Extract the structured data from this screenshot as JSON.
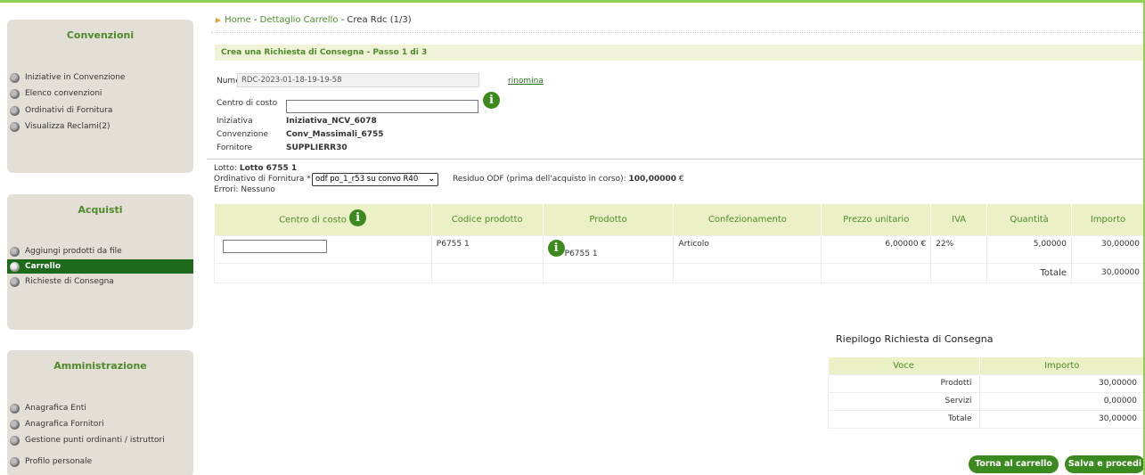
{
  "sidebar": {
    "sections": [
      {
        "title": "Convenzioni",
        "items": [
          {
            "label": "Iniziative in Convenzione"
          },
          {
            "label": "Elenco convenzioni"
          },
          {
            "label": "Ordinativi di Fornitura"
          },
          {
            "label": "Visualizza Reclami(2)"
          }
        ]
      },
      {
        "title": "Acquisti",
        "items": [
          {
            "label": "Aggiungi prodotti da file"
          },
          {
            "label": "Carrello",
            "active": true
          },
          {
            "label": "Richieste di Consegna"
          }
        ]
      },
      {
        "title": "Amministrazione",
        "items": [
          {
            "label": "Anagrafica Enti"
          },
          {
            "label": "Anagrafica Fornitori"
          },
          {
            "label": "Gestione punti ordinanti / istruttori"
          },
          {
            "label": "Profilo personale"
          }
        ]
      }
    ]
  },
  "breadcrumb": {
    "home": "Home",
    "sep1": " - ",
    "cart": "Dettaglio Carrello",
    "sep2": " - ",
    "current": "Crea Rdc (1/3)"
  },
  "step_title": "Crea una Richiesta di Consegna - Passo 1 di 3",
  "form": {
    "numero_label": "Numero Rdc Ente",
    "numero_value": "RDC-2023-01-18-19-19-58",
    "rename_link": "rinomina",
    "centro_label": "Centro di costo",
    "centro_value": "",
    "iniziativa_label": "Iniziativa",
    "iniziativa_value": "Iniziativa_NCV_6078",
    "convenzione_label": "Convenzione",
    "convenzione_value": "Conv_Massimali_6755",
    "fornitore_label": "Fornitore",
    "fornitore_value": "SUPPLIERR30"
  },
  "lotto": {
    "lotto_label": "Lotto:",
    "lotto_value": "Lotto 6755 1",
    "ordinativo_label": "Ordinativo di Fornitura *",
    "ordinativo_selected": "odf po_1_r53 su convo R40",
    "residuo_label": "Residuo ODF (prima dell'acquisto in corso):",
    "residuo_value": "100,00000",
    "residuo_currency": "€",
    "errori_label": "Errori:",
    "errori_value": "Nessuno"
  },
  "cart_table": {
    "headers": [
      "Centro di costo",
      "Codice prodotto",
      "Prodotto",
      "Confezionamento",
      "Prezzo unitario",
      "IVA",
      "Quantità",
      "Importo"
    ],
    "row": {
      "centro": "",
      "codice": "P6755 1",
      "prodotto": "P6755 1",
      "confezionamento": "Articolo",
      "prezzo": "6,00000 €",
      "iva": "22%",
      "quantita": "5,00000",
      "importo": "30,00000"
    },
    "totale_label": "Totale",
    "totale_value": "30,00000"
  },
  "summary": {
    "title": "Riepilogo Richiesta di Consegna",
    "headers": [
      "Voce",
      "Importo"
    ],
    "rows": [
      {
        "voce": "Prodotti",
        "importo": "30,00000"
      },
      {
        "voce": "Servizi",
        "importo": "0,00000"
      },
      {
        "voce": "Totale",
        "importo": "30,00000"
      }
    ]
  },
  "buttons": {
    "back": "Torna al carrello",
    "save": "Salva e procedi"
  },
  "colors": {
    "accent": "#4e8a2b",
    "active": "#1d6b1a",
    "button": "#3b8a1f",
    "header_bg": "#ecf0c6"
  }
}
